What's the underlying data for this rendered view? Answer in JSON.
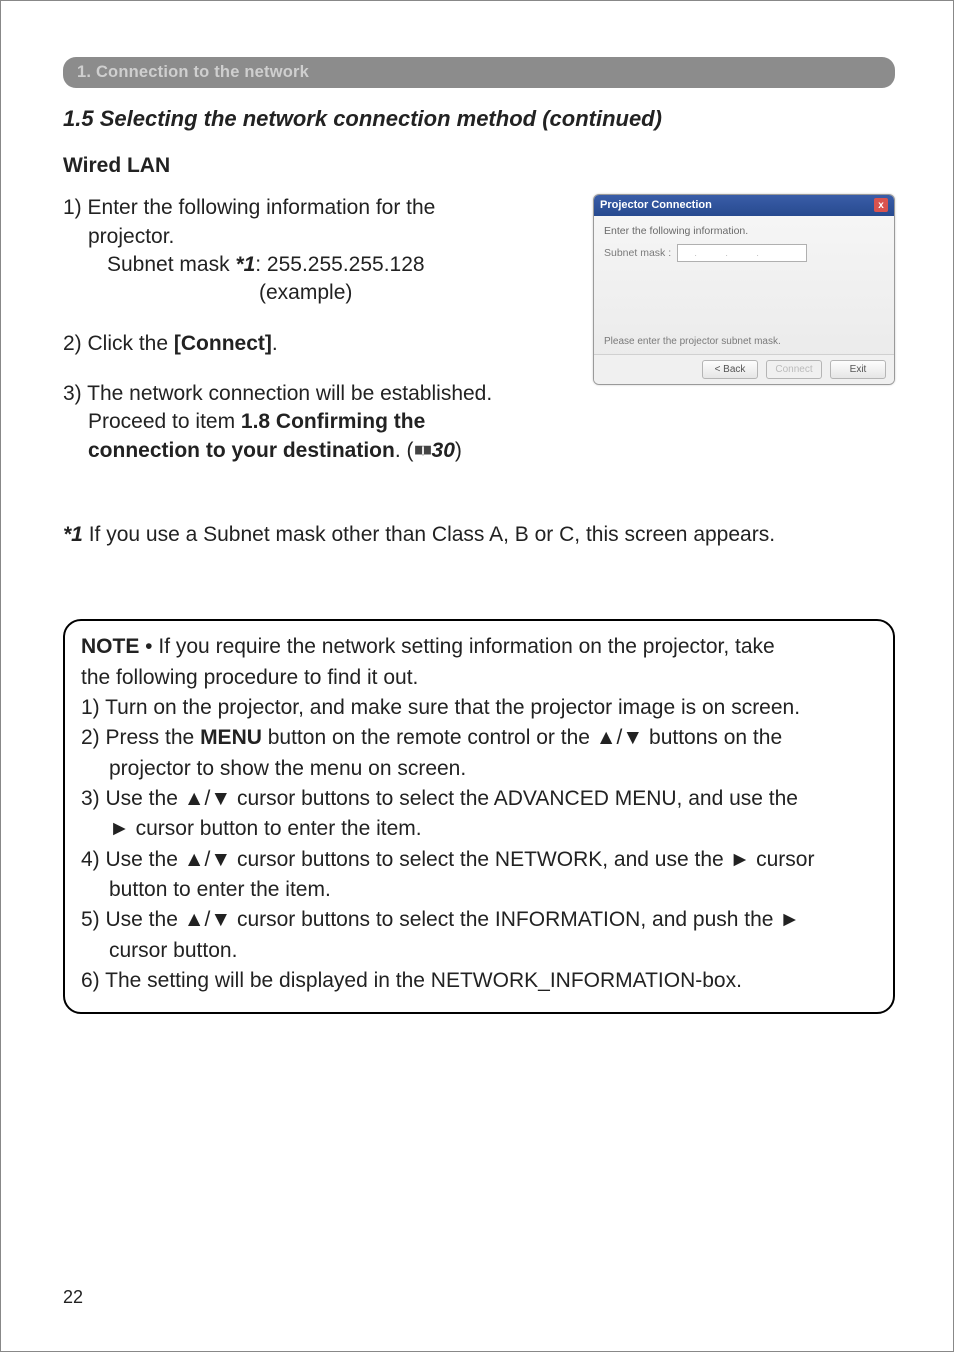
{
  "header": {
    "section_bar": "1. Connection to the network",
    "subtitle": "1.5 Selecting the network connection method (continued)"
  },
  "wired_lan_heading": "Wired LAN",
  "steps": {
    "s1_lead": "1) Enter the following information for the",
    "s1_line2": "projector.",
    "s1_subnet_label": "Subnet mask ",
    "s1_subnet_marker": "*1",
    "s1_subnet_value": ": 255.255.255.128",
    "s1_example": "(example)",
    "s2_lead": "2) Click the ",
    "s2_connect": "[Connect]",
    "s2_trail": ".",
    "s3_lead": "3) The network connection will be established.",
    "s3_proceed_a": "Proceed to item ",
    "s3_proceed_b": "1.8 Confirming the",
    "s3_proceed_c": "connection to your destination",
    "s3_trail": ". (",
    "s3_ref": "30",
    "s3_close": ")"
  },
  "footnote": {
    "marker": "*1",
    "text": " If you use a Subnet mask other than Class A, B or C, this screen appears."
  },
  "note": {
    "label": "NOTE",
    "bullet": " • ",
    "intro_a": "If you require the network setting information on the projector, take",
    "intro_b": "the following procedure to find it out.",
    "n1": "1) Turn on the projector, and make sure that the projector image is on screen.",
    "n2_a": "2) Press the ",
    "n2_menu": "MENU",
    "n2_b": " button on the remote control or the ▲/▼ buttons on the",
    "n2_c": "projector to show the menu on screen.",
    "n3_a": "3) Use the ▲/▼ cursor buttons to select the ADVANCED MENU, and use the",
    "n3_b": "► cursor button to enter the item.",
    "n4_a": "4) Use the ▲/▼ cursor buttons to select the NETWORK, and use the ► cursor",
    "n4_b": "button to enter the item.",
    "n5_a": "5) Use the ▲/▼ cursor buttons to select the INFORMATION, and push the ►",
    "n5_b": "cursor button.",
    "n6": "6) The setting will be displayed in the NETWORK_INFORMATION-box."
  },
  "dialog": {
    "title": "Projector Connection",
    "instruction": "Enter the following information.",
    "subnet_label": "Subnet mask  :",
    "hint": "Please enter the projector subnet mask.",
    "btn_back": "< Back",
    "btn_connect": "Connect",
    "btn_exit": "Exit"
  },
  "page_number": "22"
}
